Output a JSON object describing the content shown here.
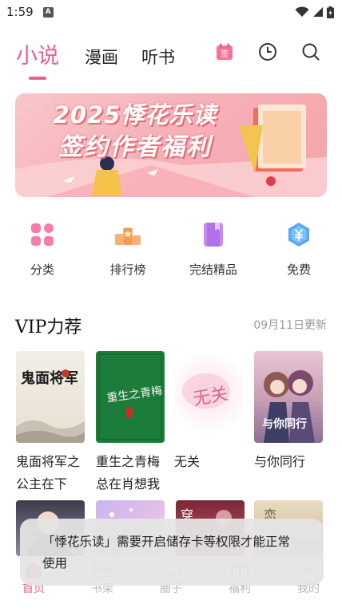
{
  "status_bar": {
    "time": "1:59",
    "notification_badge": "A"
  },
  "top_tabs": [
    {
      "label": "小说",
      "active": true
    },
    {
      "label": "漫画",
      "active": false
    },
    {
      "label": "听书",
      "active": false
    }
  ],
  "top_icons": [
    "checkin-calendar-icon",
    "history-clock-icon",
    "search-icon"
  ],
  "checkin_label": "签",
  "banner": {
    "line1": "2025悸花乐读",
    "line2": "签约作者福利"
  },
  "quick_entries": [
    {
      "label": "分类",
      "icon": "category-grid-icon"
    },
    {
      "label": "排行榜",
      "icon": "ranking-podium-icon"
    },
    {
      "label": "完结精品",
      "icon": "finished-book-icon"
    },
    {
      "label": "免费",
      "icon": "free-yen-icon"
    }
  ],
  "vip_section": {
    "title": "VIP力荐",
    "update_text": "09月11日更新"
  },
  "books": [
    {
      "title": "鬼面将军之公主在下",
      "cover_text": "鬼面将军"
    },
    {
      "title": "重生之青梅总在肖想我",
      "cover_text": "重生之青梅"
    },
    {
      "title": "无关",
      "cover_text": "无关"
    },
    {
      "title": "与你同行",
      "cover_text": "与你同行"
    }
  ],
  "second_row_covers": [
    "",
    "",
    "穿",
    "恋"
  ],
  "toast": {
    "message": "「悸花乐读」需要开启储存卡等权限才能正常使用"
  },
  "bottom_nav": [
    {
      "label": "首页",
      "icon": "home-icon",
      "active": true
    },
    {
      "label": "书架",
      "icon": "bookshelf-icon",
      "active": false
    },
    {
      "label": "圈子",
      "icon": "chat-bubble-icon",
      "active": false
    },
    {
      "label": "福利",
      "icon": "gift-icon",
      "active": false
    },
    {
      "label": "我的",
      "icon": "profile-icon",
      "active": false
    }
  ],
  "colors": {
    "accent": "#ea5f8e",
    "inactive": "#b8b8b8",
    "banner": "#f6b2b8"
  }
}
